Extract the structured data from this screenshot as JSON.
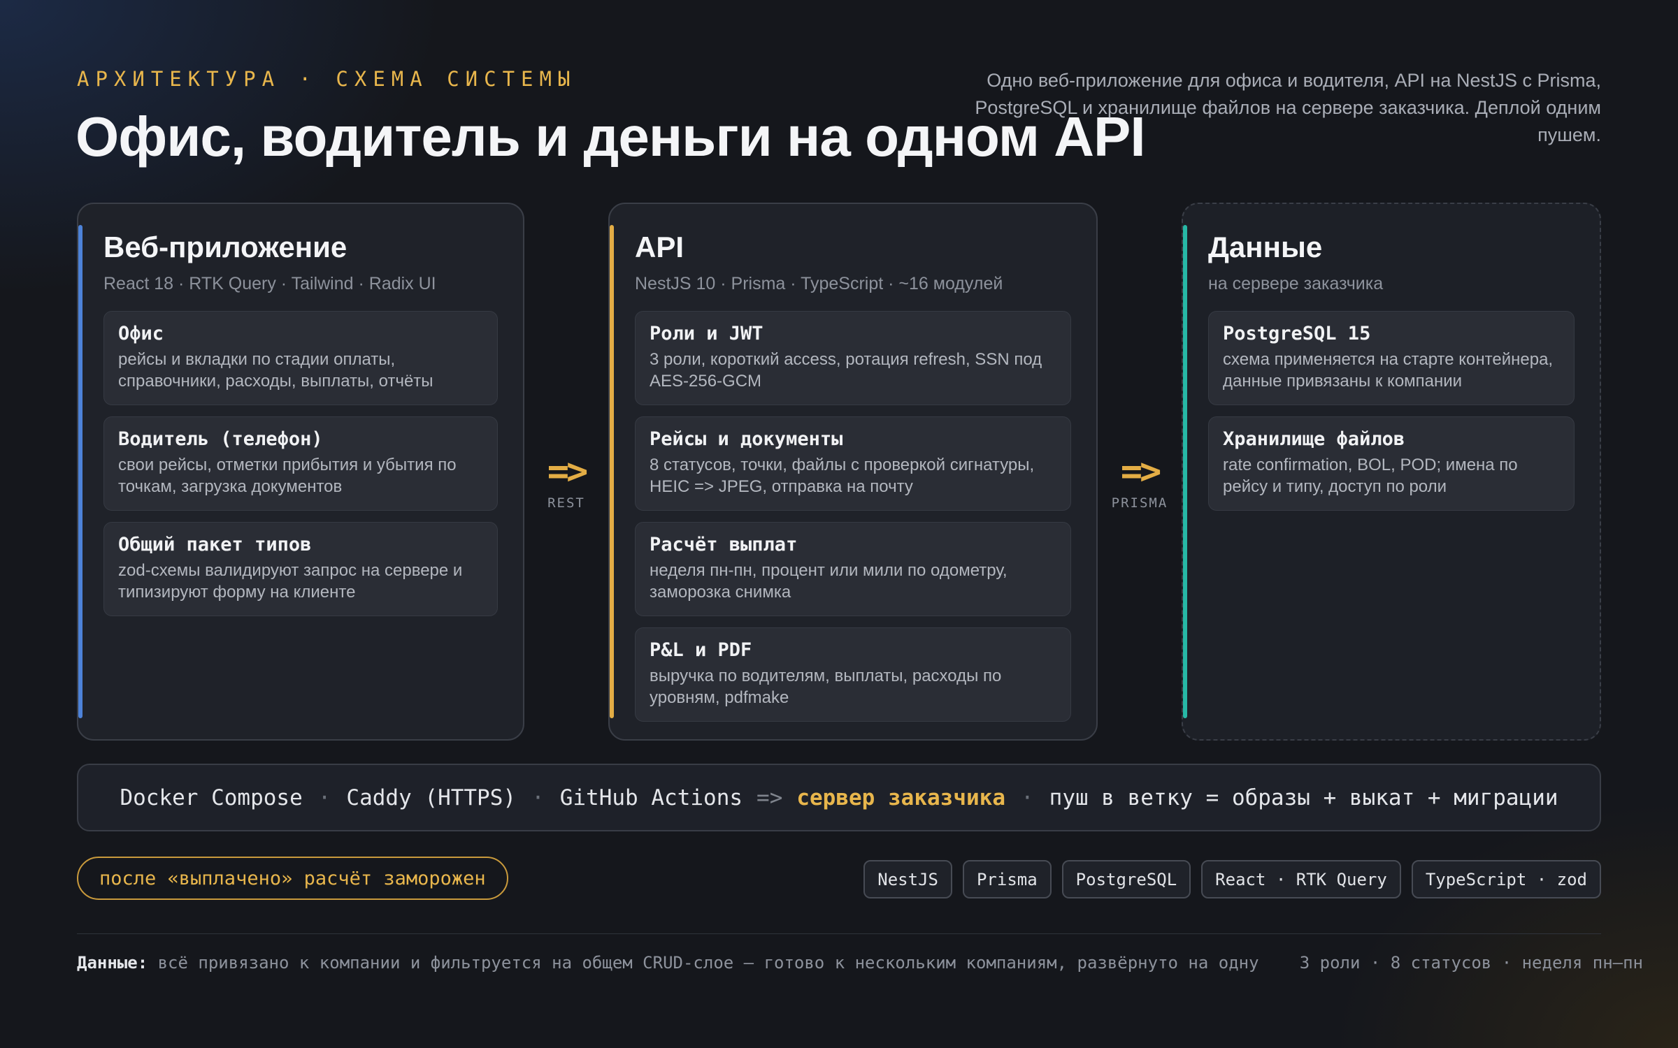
{
  "header": {
    "eyebrow": "АРХИТЕКТУРА · СХЕМА СИСТЕМЫ",
    "title": "Офис, водитель и деньги на одном API",
    "subtitle": "Одно веб-приложение для офиса и водителя, API на NestJS с Prisma, PostgreSQL и хранилище файлов на сервере заказчика. Деплой одним пушем."
  },
  "colors": {
    "web": "#4d82d8",
    "api": "#e3ad45",
    "data": "#27b8a6",
    "highlight": "#e8b64c"
  },
  "columns": {
    "web": {
      "title": "Веб-приложение",
      "stack": "React 18 · RTK Query · Tailwind · Radix UI",
      "cards": [
        {
          "title": "Офис",
          "desc": "рейсы и вкладки по стадии оплаты, справочники, расходы, выплаты, отчёты"
        },
        {
          "title": "Водитель (телефон)",
          "desc": "свои рейсы, отметки прибытия и убытия по точкам, загрузка документов"
        },
        {
          "title": "Общий пакет типов",
          "desc": "zod-схемы валидируют запрос на сервере и типизируют форму на клиенте"
        }
      ]
    },
    "api": {
      "title": "API",
      "stack": "NestJS 10 · Prisma · TypeScript · ~16 модулей",
      "cards": [
        {
          "title": "Роли и JWT",
          "desc": "3 роли, короткий access, ротация refresh, SSN под AES-256-GCM"
        },
        {
          "title": "Рейсы и документы",
          "desc": "8 статусов, точки, файлы с проверкой сигнатуры, HEIC => JPEG, отправка на почту"
        },
        {
          "title": "Расчёт выплат",
          "desc": "неделя пн-пн, процент или мили по одометру, заморозка снимка"
        },
        {
          "title": "P&L и PDF",
          "desc": "выручка по водителям, выплаты, расходы по уровням, pdfmake"
        }
      ]
    },
    "data": {
      "title": "Данные",
      "stack": "на сервере заказчика",
      "cards": [
        {
          "title": "PostgreSQL 15",
          "desc": "схема применяется на старте контейнера, данные привязаны к компании"
        },
        {
          "title": "Хранилище файлов",
          "desc": "rate confirmation, BOL, POD; имена по рейсу и типу, доступ по роли"
        }
      ]
    }
  },
  "arrows": {
    "rest": {
      "symbol": "=>",
      "label": "REST"
    },
    "prisma": {
      "symbol": "=>",
      "label": "PRISMA"
    }
  },
  "deploy": {
    "docker": "Docker Compose",
    "caddy": "Caddy (HTTPS)",
    "github": "GitHub Actions",
    "arrow": "=>",
    "server": "сервер заказчика",
    "push": "пуш в ветку = образы + выкат + миграции",
    "sep": "·"
  },
  "note": "после «выплачено» расчёт заморожен",
  "tags": [
    "NestJS",
    "Prisma",
    "PostgreSQL",
    "React · RTK Query",
    "TypeScript · zod"
  ],
  "footer": {
    "label": "Данные:",
    "text": "всё привязано к компании и фильтруется на общем CRUD-слое — готово к нескольким компаниям, развёрнуто на одну",
    "stats": "3 роли · 8 статусов · неделя пн–пн"
  }
}
